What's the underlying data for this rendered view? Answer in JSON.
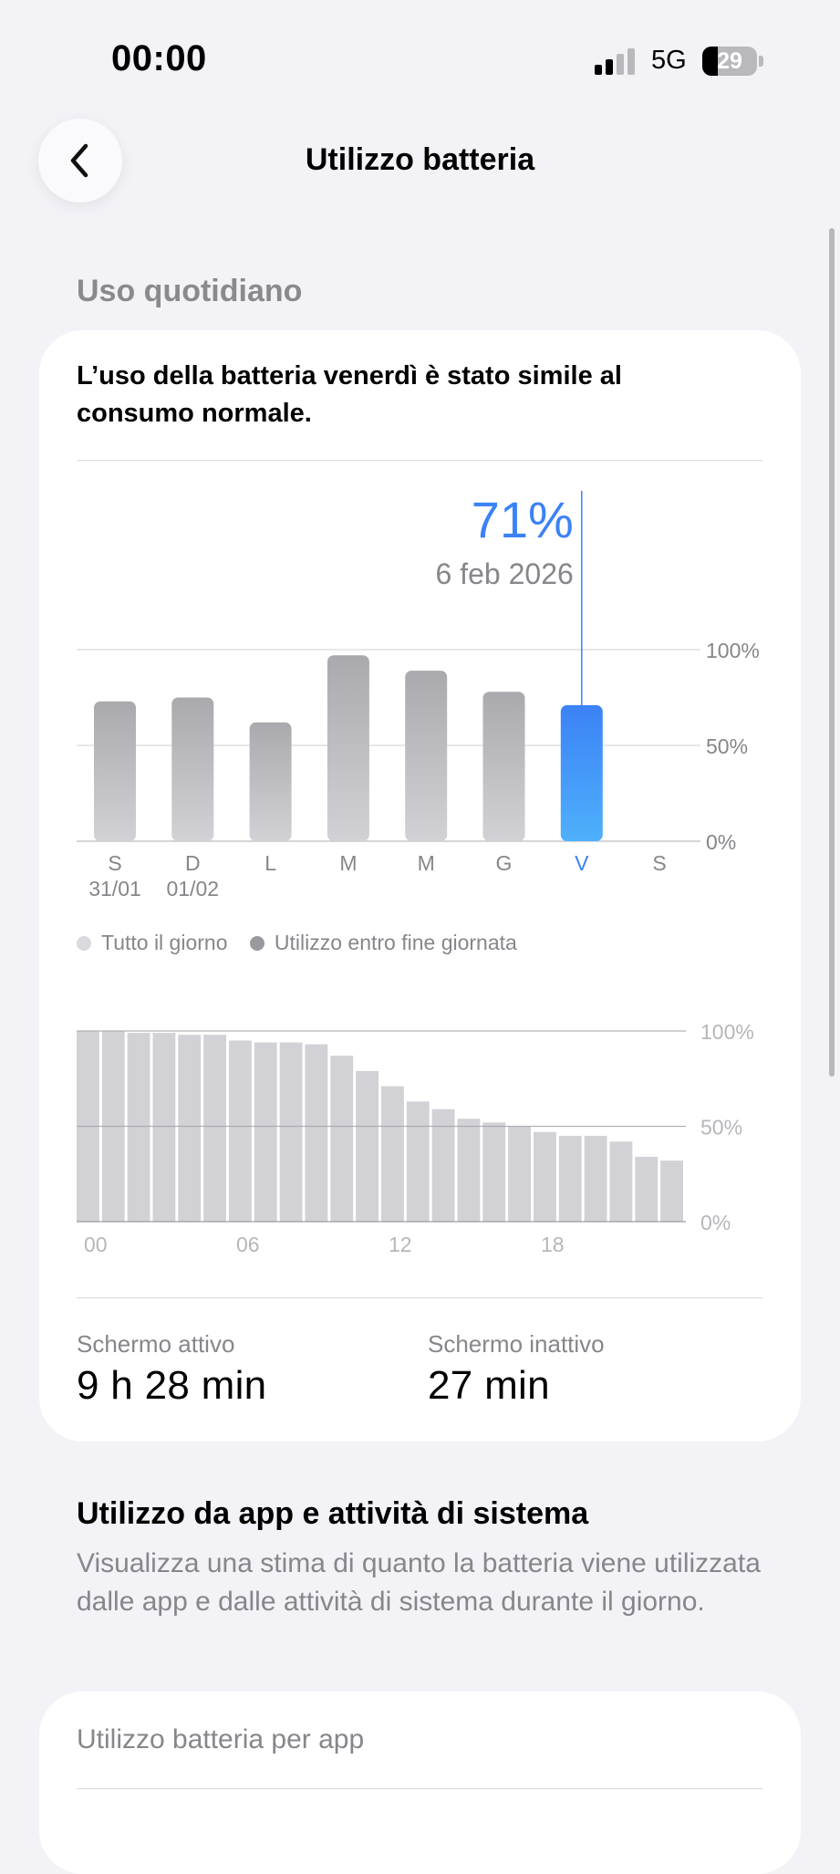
{
  "status_bar": {
    "time": "00:00",
    "network": "5G",
    "battery_percent": "29",
    "signal_bars_active": 2,
    "signal_bars_total": 4
  },
  "nav": {
    "title": "Utilizzo batteria",
    "back_icon": "chevron-left-icon"
  },
  "daily": {
    "section_header": "Uso quotidiano",
    "message": "L’uso della batteria venerdì è stato simile al consumo normale."
  },
  "colors": {
    "accent": "#3b82f6",
    "bar_gray": "#b0b0b4",
    "hourly_gray": "#d1d1d6",
    "text_secondary": "#86868b"
  },
  "chart_data": [
    {
      "type": "bar",
      "categories": [
        "S",
        "D",
        "L",
        "M",
        "M",
        "G",
        "V",
        "S"
      ],
      "date_labels": [
        "31/01",
        "01/02",
        "",
        "",
        "",
        "",
        "",
        ""
      ],
      "values": [
        73,
        75,
        62,
        97,
        89,
        78,
        71,
        null
      ],
      "selected_index": 6,
      "selected_value_label": "71%",
      "selected_date_label": "6 feb 2026",
      "ylim": [
        0,
        100
      ],
      "y_ticks": [
        "0%",
        "50%",
        "100%"
      ],
      "grid": true,
      "legend": [
        {
          "label": "Tutto il giorno",
          "color": "#d9d9de"
        },
        {
          "label": "Utilizzo entro fine giornata",
          "color": "#9a9a9e"
        }
      ]
    },
    {
      "type": "bar",
      "x_ticks": [
        "00",
        "06",
        "12",
        "18"
      ],
      "values": [
        100,
        100,
        99,
        99,
        98,
        98,
        95,
        94,
        94,
        93,
        87,
        79,
        71,
        63,
        59,
        54,
        52,
        50,
        47,
        45,
        45,
        42,
        34,
        32
      ],
      "ylim": [
        0,
        100
      ],
      "y_ticks": [
        "0%",
        "50%",
        "100%"
      ],
      "grid": true
    }
  ],
  "screen": {
    "active_label": "Schermo attivo",
    "active_value": "9 h 28 min",
    "inactive_label": "Schermo inattivo",
    "inactive_value": "27 min"
  },
  "apps": {
    "title": "Utilizzo da app e attività di sistema",
    "description": "Visualizza una stima di quanto la batteria viene utilizzata dalle app e dalle attività di sistema durante il giorno.",
    "card_label": "Utilizzo batteria per app"
  }
}
